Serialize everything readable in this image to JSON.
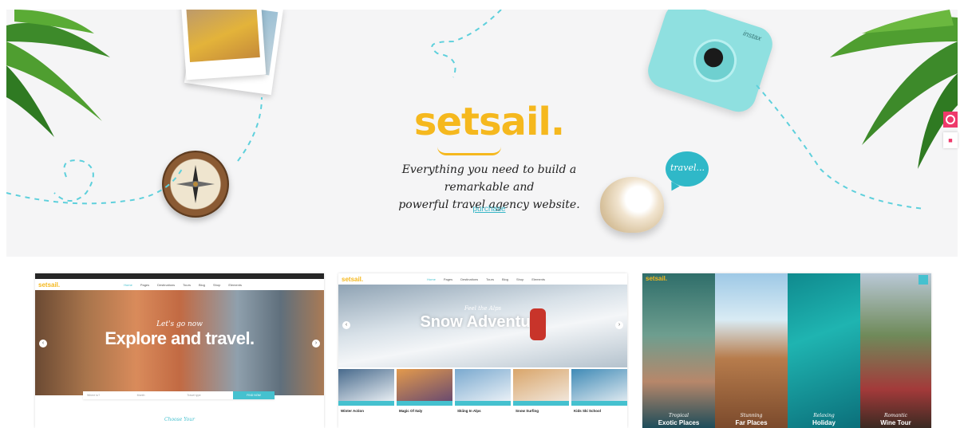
{
  "hero": {
    "brand": "setsail.",
    "tagline_line1": "Everything you need to build a remarkable and",
    "tagline_line2": "powerful travel agency website.",
    "purchase": "purchase",
    "bubble": "travel...",
    "camera_brand": "instax"
  },
  "colors": {
    "accent": "#f5b81e",
    "teal": "#45c1cf",
    "pink": "#ee3a6b"
  },
  "side_icons": [
    "ring-icon",
    "cart-icon"
  ],
  "demo1": {
    "logo": "setsail.",
    "nav": [
      "Home",
      "Pages",
      "Destinations",
      "Tours",
      "Blog",
      "Shop",
      "Elements"
    ],
    "script": "Let's go now",
    "headline": "Explore and travel.",
    "search_fields": [
      "Where to?",
      "Month",
      "Travel type"
    ],
    "search_button": "FIND NOW",
    "choose": "Choose Your"
  },
  "demo2": {
    "logo": "setsail.",
    "nav": [
      "Home",
      "Pages",
      "Destinations",
      "Tours",
      "Blog",
      "Shop",
      "Elements"
    ],
    "script": "Feel the Alps",
    "headline": "Snow Adventure",
    "tours": [
      {
        "title": "Winter Action"
      },
      {
        "title": "Magic Of Italy"
      },
      {
        "title": "Skiing In Alps"
      },
      {
        "title": "Snow Surfing"
      },
      {
        "title": "Kids Ski School"
      }
    ]
  },
  "demo3": {
    "logo": "setsail.",
    "panels": [
      {
        "script": "Tropical",
        "title": "Exotic Places"
      },
      {
        "script": "Stunning",
        "title": "Far Places"
      },
      {
        "script": "Relaxing",
        "title": "Holiday"
      },
      {
        "script": "Romantic",
        "title": "Wine Tour"
      }
    ]
  }
}
